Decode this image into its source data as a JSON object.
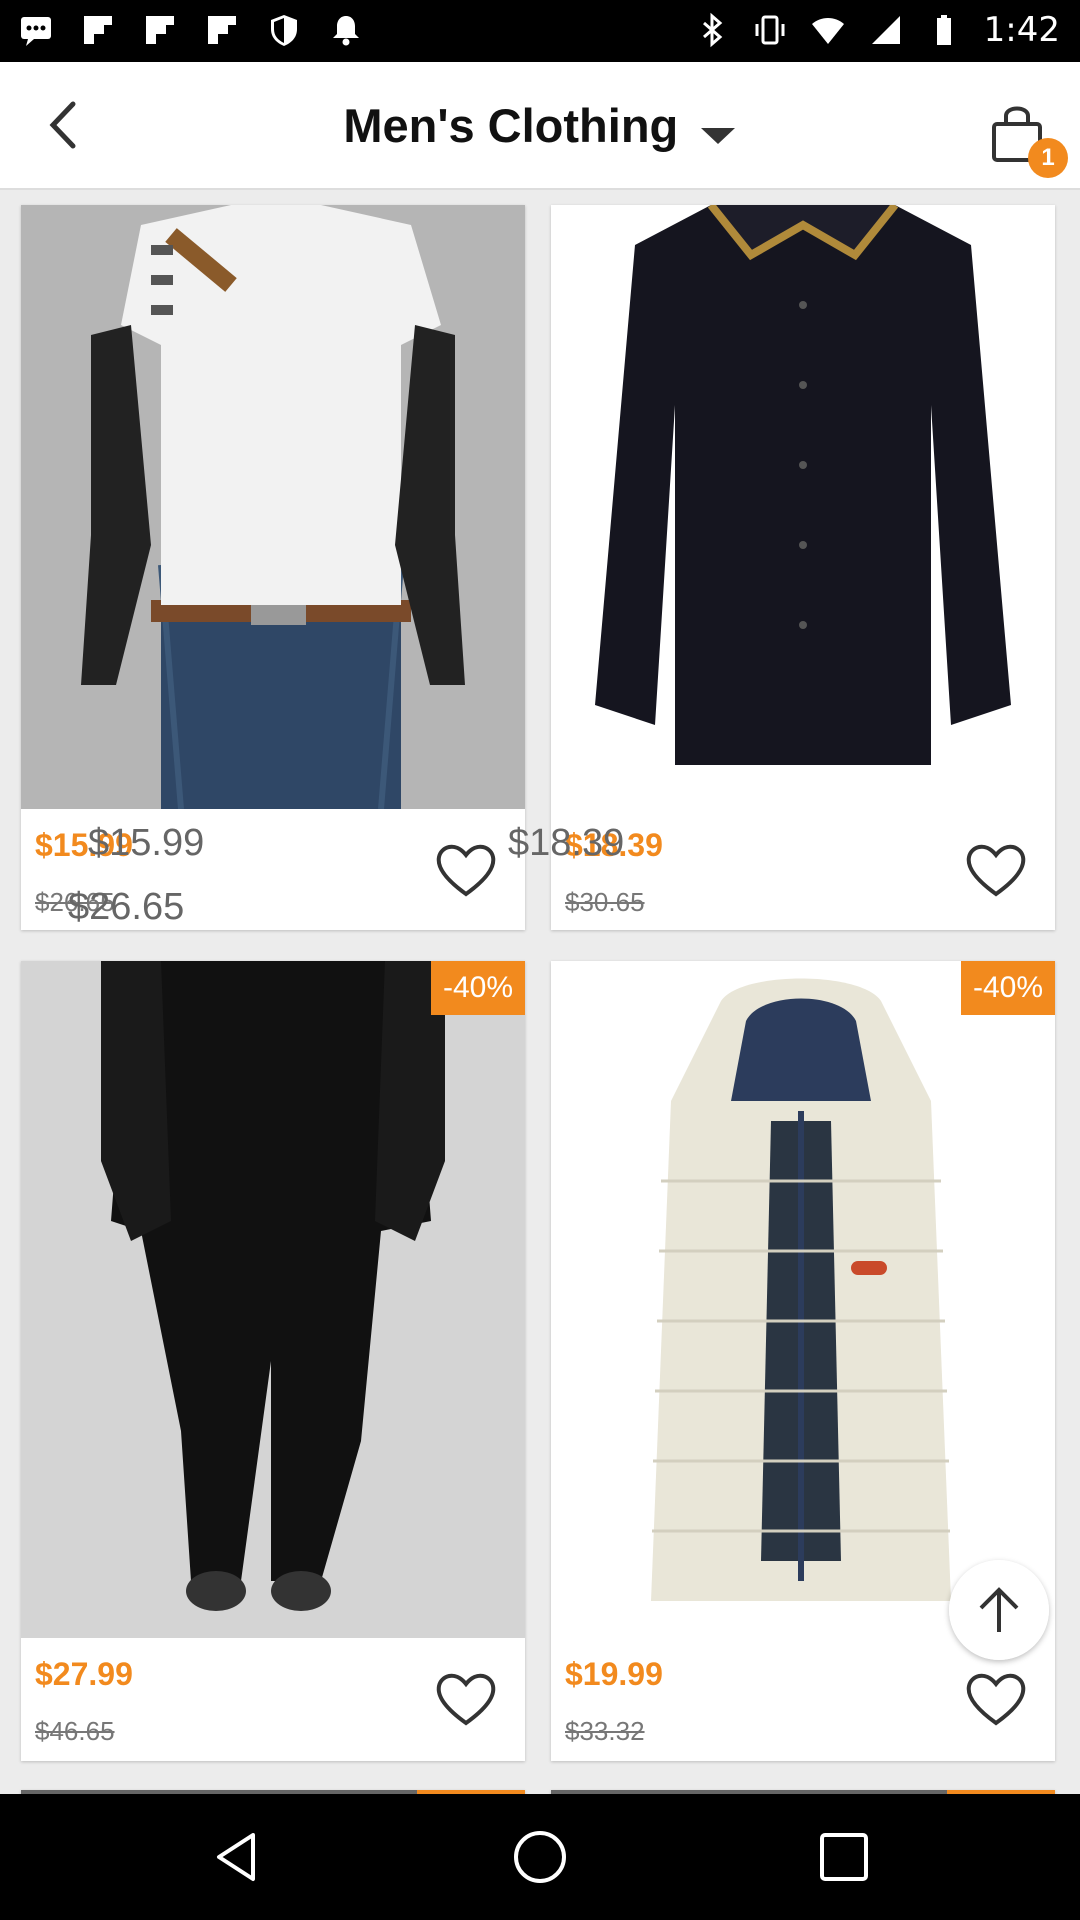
{
  "status_bar": {
    "time": "1:42",
    "left_icons": [
      "messages-icon",
      "flipboard-icon",
      "flipboard-icon",
      "flipboard-icon",
      "shield-icon",
      "notification-icon"
    ],
    "right_icons": [
      "bluetooth-icon",
      "vibrate-icon",
      "wifi-icon",
      "signal-icon",
      "battery-icon"
    ]
  },
  "header": {
    "title": "Men's Clothing",
    "cart_count": "1"
  },
  "products": [
    {
      "price": "$15.99",
      "old_price": "$26.65",
      "discount": "",
      "image": "white-tshirt-mannequin"
    },
    {
      "price": "$18.39",
      "old_price": "$30.65",
      "discount": "",
      "image": "black-shirt-gold-collar"
    },
    {
      "price": "$27.99",
      "old_price": "$46.65",
      "discount": "-40%",
      "image": "black-harem-pants"
    },
    {
      "price": "$19.99",
      "old_price": "$33.32",
      "discount": "-40%",
      "image": "white-puffer-vest"
    }
  ],
  "overlay_texts": {
    "p1_price": "$15.99",
    "p1_old": "$26.65",
    "p2_price": "$18.39"
  },
  "colors": {
    "accent": "#f28a1e",
    "background": "#ececec"
  }
}
